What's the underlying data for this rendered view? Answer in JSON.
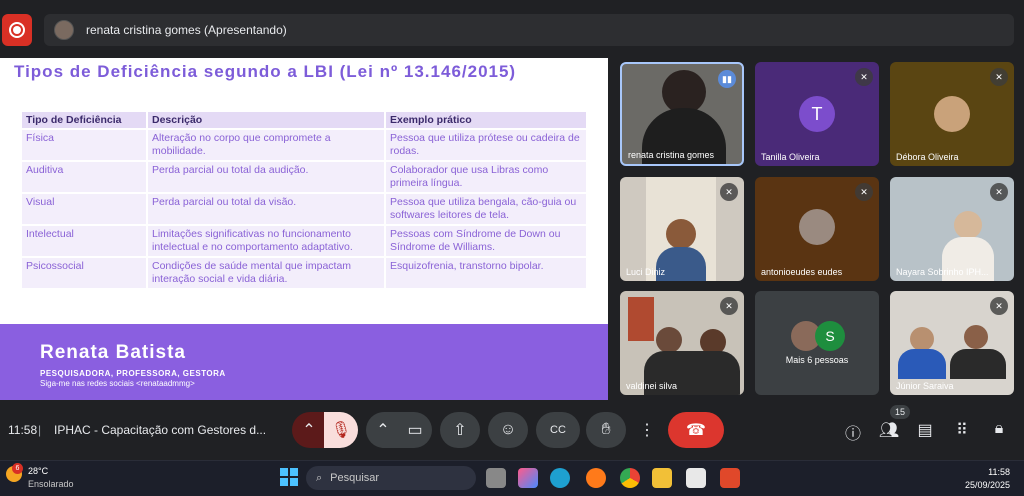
{
  "presenter_bar": {
    "text": "renata cristina gomes (Apresentando)"
  },
  "slide": {
    "title": "Tipos de Deficiência segundo a LBI (Lei nº 13.146/2015)",
    "headers": [
      "Tipo de Deficiência",
      "Descrição",
      "Exemplo prático"
    ],
    "rows": [
      [
        "Física",
        "Alteração no corpo que compromete a mobilidade.",
        "Pessoa que utiliza prótese ou cadeira de rodas."
      ],
      [
        "Auditiva",
        "Perda parcial ou total da audição.",
        "Colaborador que usa Libras como primeira língua."
      ],
      [
        "Visual",
        "Perda parcial ou total da visão.",
        "Pessoa que utiliza bengala, cão-guia ou softwares leitores de tela."
      ],
      [
        "Intelectual",
        "Limitações significativas no funcionamento intelectual e no comportamento adaptativo.",
        "Pessoas com Síndrome de Down ou Síndrome de Williams."
      ],
      [
        "Psicossocial",
        "Condições de saúde mental que impactam interação social e vida diária.",
        "Esquizofrenia, transtorno bipolar."
      ]
    ],
    "footer_name": "Renata Batista",
    "footer_roles": "PESQUISADORA, PROFESSORA, GESTORA",
    "footer_social": "Siga-me nas redes sociais <renataadmmg>"
  },
  "participants": [
    {
      "name": "renata cristina gomes",
      "kind": "video"
    },
    {
      "name": "Tanilla Oliveira",
      "kind": "letter",
      "letter": "T",
      "color": "#7c4dcc"
    },
    {
      "name": "Débora Oliveira",
      "kind": "photo"
    },
    {
      "name": "Luci Diniz",
      "kind": "video"
    },
    {
      "name": "antonioeudes eudes",
      "kind": "photo"
    },
    {
      "name": "Nayara Sobrinho IPH...",
      "kind": "video"
    },
    {
      "name": "valdinei silva",
      "kind": "video"
    },
    {
      "name": "Mais 6 pessoas",
      "kind": "more",
      "letter": "S"
    },
    {
      "name": "Júnior Saraiva",
      "kind": "video"
    }
  ],
  "meeting": {
    "time": "11:58",
    "title": "IPHAC - Capacitação com Gestores d...",
    "people_count": "15"
  },
  "taskbar": {
    "weather_temp": "28°C",
    "weather_desc": "Ensolarado",
    "weather_badge": "6",
    "search_placeholder": "Pesquisar",
    "clock_time": "11:58",
    "clock_date": "25/09/2025"
  }
}
